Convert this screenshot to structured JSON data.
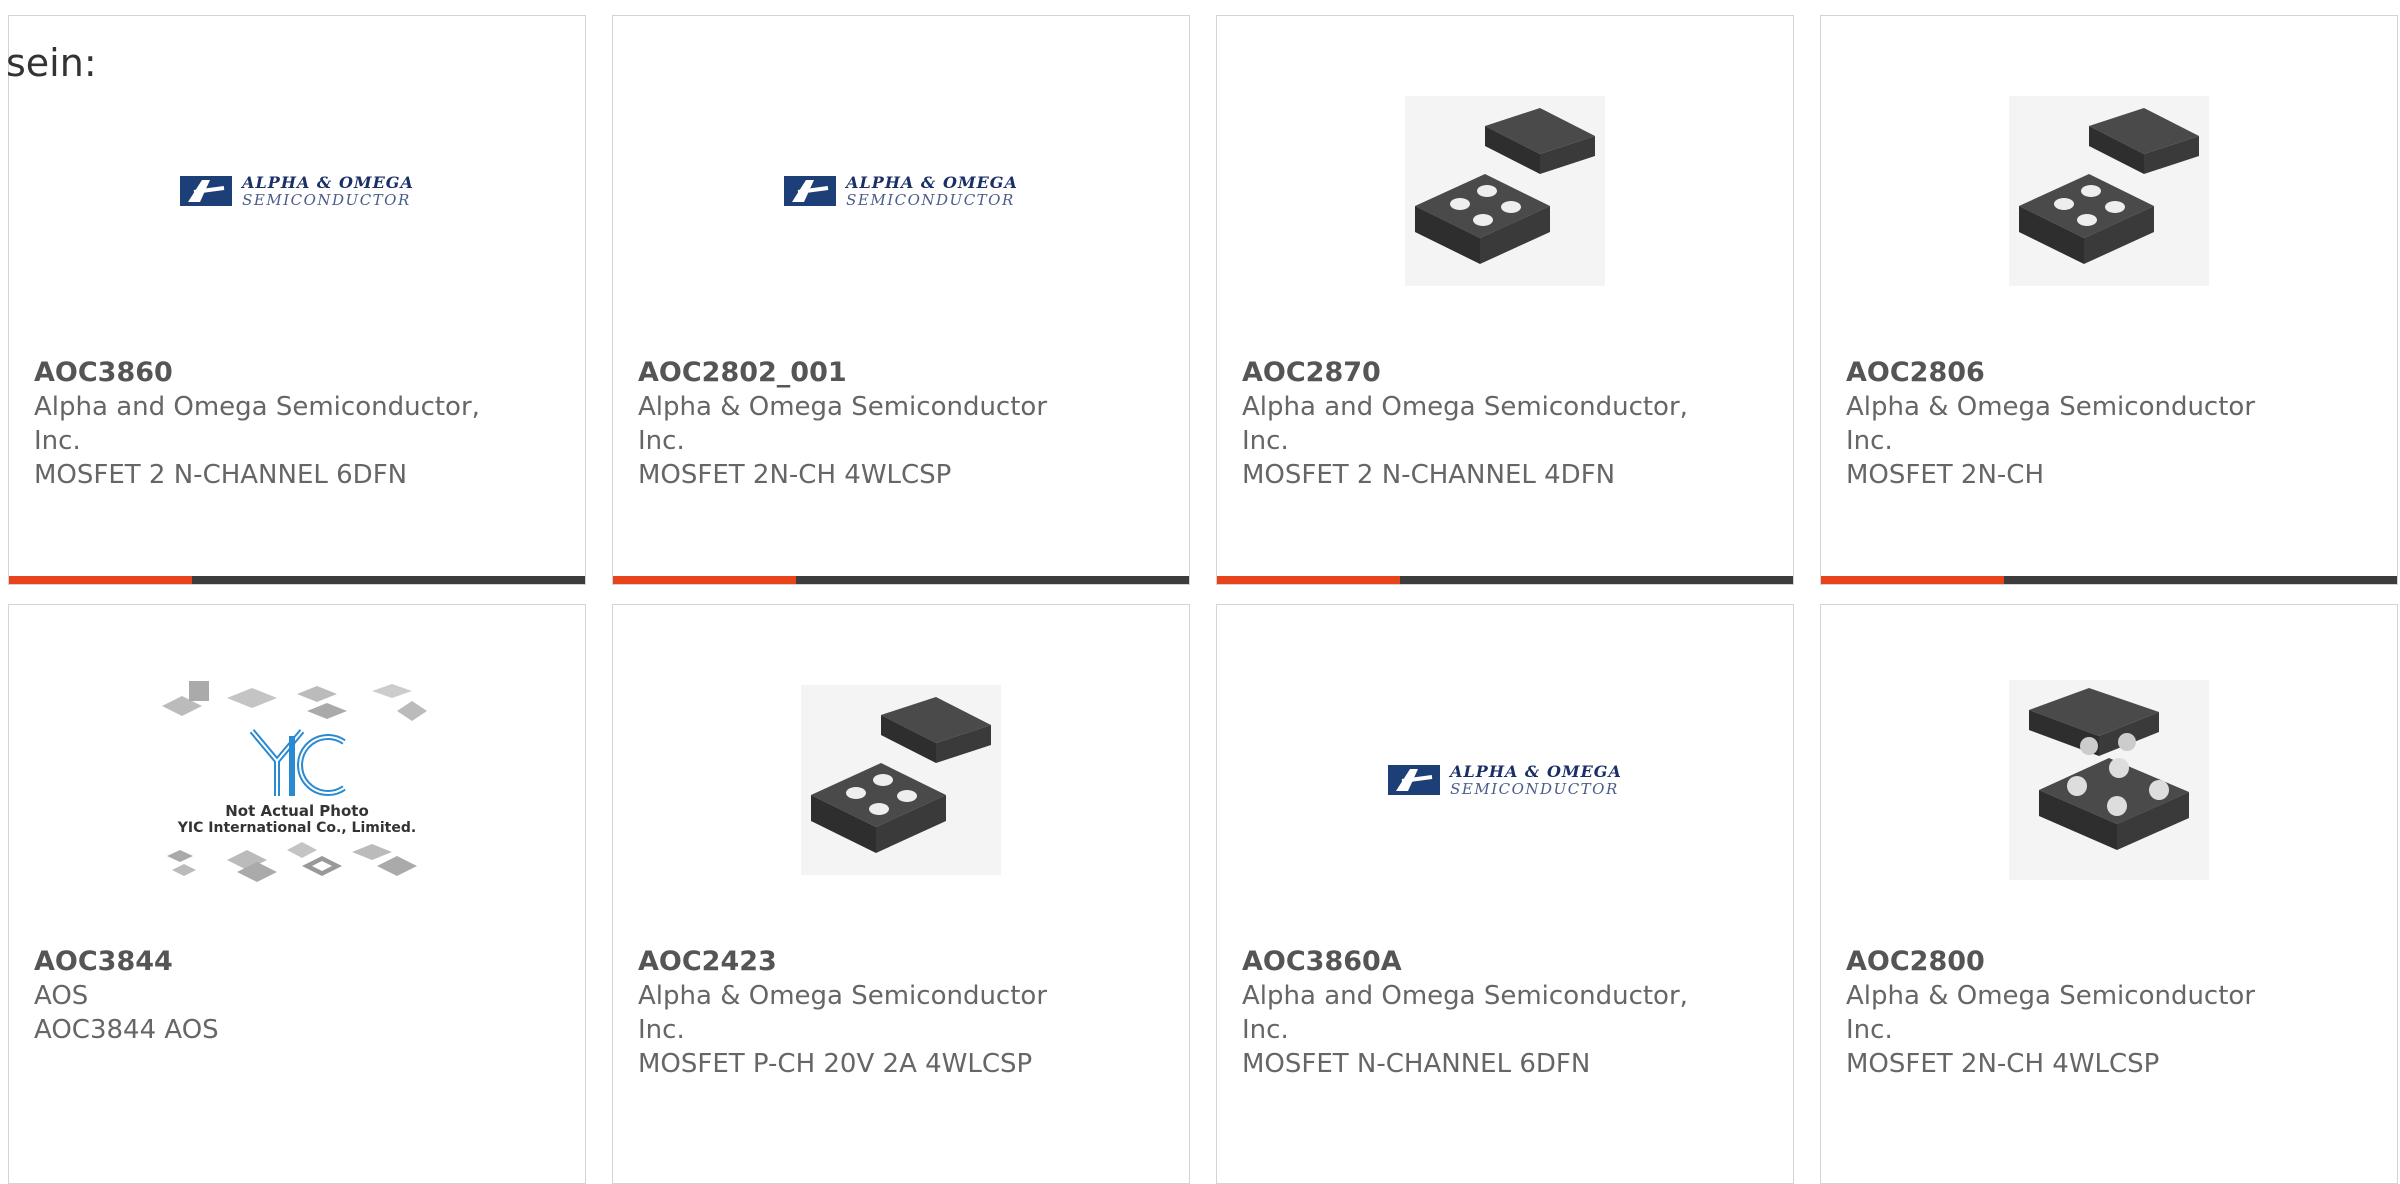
{
  "intro_text": "sein:",
  "colors": {
    "accent": "#e8431b",
    "bar": "#3c3c3c",
    "logo_blue": "#1d3f77"
  },
  "logo": {
    "line1": "ALPHA & OMEGA",
    "line2": "SEMICONDUCTOR"
  },
  "yic_caption": {
    "line1": "Not Actual Photo",
    "line2": "YIC International Co., Limited."
  },
  "products": [
    {
      "part": "AOC3860",
      "mfr_line1": "Alpha and Omega Semiconductor,",
      "mfr_line2": "Inc.",
      "desc": "MOSFET 2 N-CHANNEL 6DFN",
      "image": "alpha-omega-logo"
    },
    {
      "part": "AOC2802_001",
      "mfr_line1": "Alpha & Omega Semiconductor",
      "mfr_line2": "Inc.",
      "desc": "MOSFET 2N-CH 4WLCSP",
      "image": "alpha-omega-logo"
    },
    {
      "part": "AOC2870",
      "mfr_line1": "Alpha and Omega Semiconductor,",
      "mfr_line2": "Inc.",
      "desc": "MOSFET 2 N-CHANNEL 4DFN",
      "image": "chip-4pad"
    },
    {
      "part": "AOC2806",
      "mfr_line1": "Alpha & Omega Semiconductor",
      "mfr_line2": "Inc.",
      "desc": "MOSFET 2N-CH",
      "image": "chip-4pad"
    },
    {
      "part": "AOC3844",
      "mfr_line1": "AOS",
      "mfr_line2": "",
      "desc": "AOC3844 AOS",
      "image": "yic-not-actual-photo"
    },
    {
      "part": "AOC2423",
      "mfr_line1": "Alpha & Omega Semiconductor",
      "mfr_line2": "Inc.",
      "desc": "MOSFET P-CH 20V 2A 4WLCSP",
      "image": "chip-4pad"
    },
    {
      "part": "AOC3860A",
      "mfr_line1": "Alpha and Omega Semiconductor,",
      "mfr_line2": "Inc.",
      "desc": "MOSFET N-CHANNEL 6DFN",
      "image": "alpha-omega-logo"
    },
    {
      "part": "AOC2800",
      "mfr_line1": "Alpha & Omega Semiconductor",
      "mfr_line2": "Inc.",
      "desc": "MOSFET 2N-CH 4WLCSP",
      "image": "chip-4ball"
    }
  ]
}
